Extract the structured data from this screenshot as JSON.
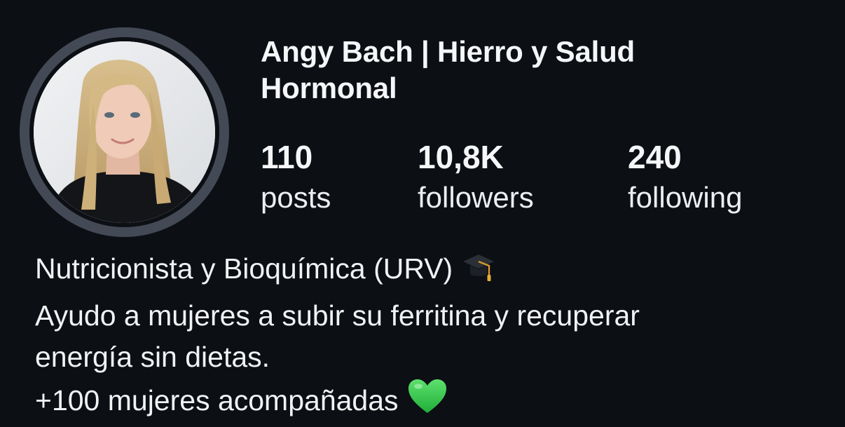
{
  "profile": {
    "display_name": "Angy Bach | Hierro y Salud Hormonal",
    "avatar_icon": "profile-photo"
  },
  "stats": {
    "posts": {
      "value": "110",
      "label": "posts"
    },
    "followers": {
      "value": "10,8K",
      "label": "followers"
    },
    "following": {
      "value": "240",
      "label": "following"
    }
  },
  "bio": {
    "lines": [
      "Nutricionista y Bioquímica (URV)",
      "Ayudo a mujeres a subir su ferritina y recuperar",
      "energía sin dietas.",
      "+100 mujeres acompañadas"
    ],
    "line1_emoji": "graduation-cap-icon",
    "line4_emoji": "green-heart-icon"
  },
  "colors": {
    "background": "#0c0f14",
    "avatar_ring": "#434a55",
    "text": "#f3f4f6",
    "heart": "#2fc84a"
  }
}
